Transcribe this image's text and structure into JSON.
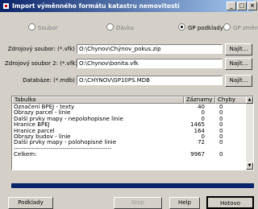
{
  "window": {
    "title": "Import výměnného formátu katastru nemovitostí",
    "min_glyph": "_",
    "max_glyph": "□",
    "close_glyph": "×"
  },
  "source_options": [
    {
      "label": "Soubor",
      "selected": false,
      "enabled": false
    },
    {
      "label": "Dávka",
      "selected": false,
      "enabled": false
    },
    {
      "label": "GP podklady",
      "selected": true,
      "enabled": true
    },
    {
      "label": "GP změny",
      "selected": false,
      "enabled": false
    }
  ],
  "fields": [
    {
      "label": "Zdrojový soubor: (*.vfk)",
      "value": "O:\\Chynov\\Chýnov_pokus.zip",
      "button": "Najít..."
    },
    {
      "label": "Zdrojový soubor 2: (*.vfk)",
      "value": "O:\\Chynov\\bonita.vfk",
      "button": "Najít..."
    },
    {
      "label": "Databáze: (*.mdb)",
      "value": "O:\\CHYNOV\\GP10PS.MDB",
      "button": "Najít..."
    }
  ],
  "table": {
    "columns": [
      "Tabulka",
      "Záznamy",
      "Chyby"
    ],
    "rows": [
      {
        "name": "Označení BPEJ - texty",
        "records": "40",
        "errors": "0"
      },
      {
        "name": "Obrazy parcel - linie",
        "records": "0",
        "errors": "0"
      },
      {
        "name": "Další prvky mapy - nepolohopisne linie",
        "records": "0",
        "errors": "0"
      },
      {
        "name": "Hranice BPEJ",
        "records": "1465",
        "errors": "0"
      },
      {
        "name": "Hranice parcel",
        "records": "164",
        "errors": "0"
      },
      {
        "name": "Obrazy budov - linie",
        "records": "0",
        "errors": "0"
      },
      {
        "name": "Další prvky mapy - polohopisné linie",
        "records": "72",
        "errors": "0"
      },
      {
        "name": "------------------------------------------------",
        "records": "",
        "errors": ""
      },
      {
        "name": "Celkem:",
        "records": "9967",
        "errors": "0"
      }
    ]
  },
  "progress": {
    "fraction": 1.0,
    "color": "#0a246a"
  },
  "buttons": {
    "podklady": "Podklady",
    "stop": "Stop",
    "help": "Help",
    "done": "Hotovo"
  }
}
